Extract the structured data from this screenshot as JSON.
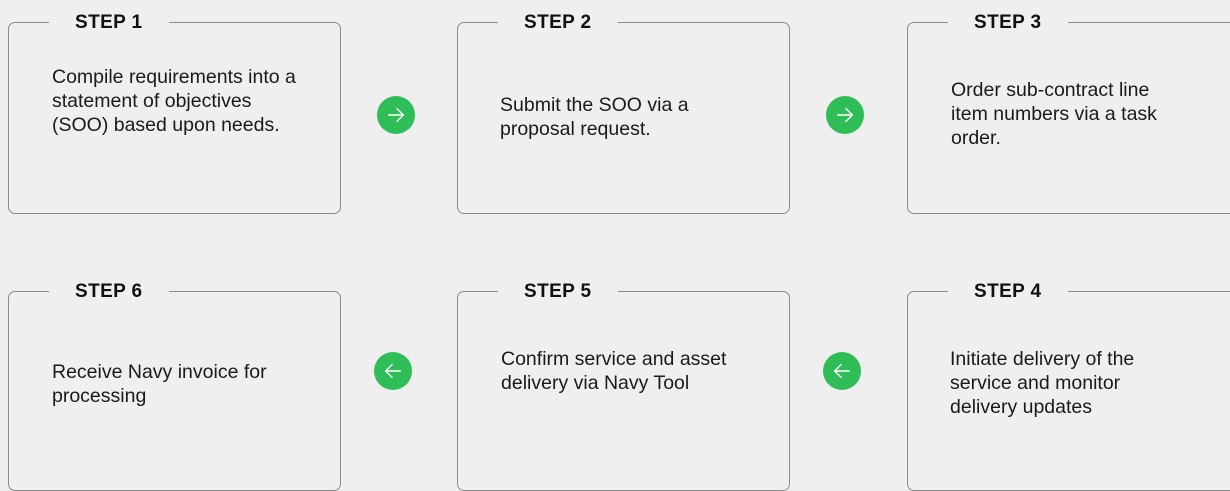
{
  "colors": {
    "accent": "#2ebd57",
    "border": "#8c8c8c",
    "background": "#efefef"
  },
  "steps": [
    {
      "label": "STEP 1",
      "text": "Compile requirements into a statement of objectives (SOO) based upon needs."
    },
    {
      "label": "STEP 2",
      "text": "Submit the SOO via a proposal request."
    },
    {
      "label": "STEP 3",
      "text": "Order sub-contract line item numbers via a task order."
    },
    {
      "label": "STEP 4",
      "text": "Initiate delivery of the service and monitor delivery updates"
    },
    {
      "label": "STEP 5",
      "text": "Confirm service and asset delivery via Navy Tool"
    },
    {
      "label": "STEP 6",
      "text": "Receive Navy invoice for processing"
    }
  ],
  "arrows": [
    {
      "icon": "arrow-right-icon",
      "direction": "right",
      "from": "STEP 1",
      "to": "STEP 2"
    },
    {
      "icon": "arrow-right-icon",
      "direction": "right",
      "from": "STEP 2",
      "to": "STEP 3"
    },
    {
      "icon": "arrow-left-icon",
      "direction": "left",
      "from": "STEP 4",
      "to": "STEP 5"
    },
    {
      "icon": "arrow-left-icon",
      "direction": "left",
      "from": "STEP 5",
      "to": "STEP 6"
    }
  ]
}
